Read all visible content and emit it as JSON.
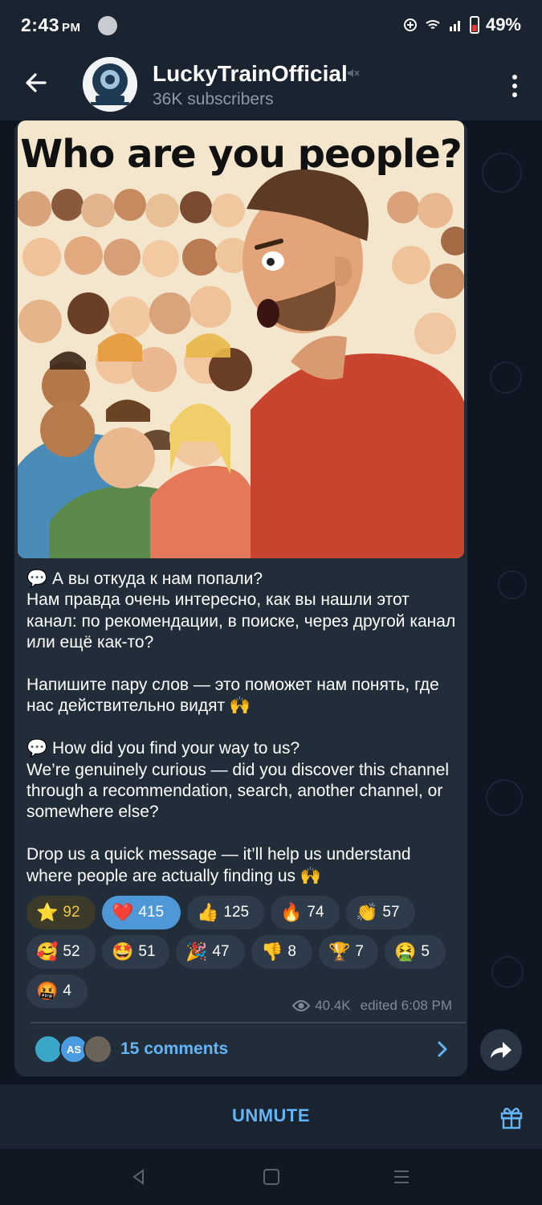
{
  "status_bar": {
    "time": "2:43",
    "ampm": "PM",
    "battery": "49%"
  },
  "header": {
    "channel_name": "LuckyTrainOfficial",
    "subscribers": "36K subscribers"
  },
  "post": {
    "image_title": "Who are you people?",
    "text": "💬 А вы откуда к нам попали?\nНам правда очень интересно, как вы нашли этот канал: по рекомендации, в поиске, через другой канал или ещё как-то?\n\nНапишите пару слов — это поможет нам понять, где нас действительно видят 🙌\n\n💬 How did you find your way to us?\nWe’re genuinely curious — did you discover this channel through a recommendation, search, another channel, or somewhere else?\n\nDrop us a quick message — it’ll help us understand where people are actually finding us 🙌",
    "reactions": [
      {
        "emoji": "⭐",
        "count": "92",
        "kind": "star"
      },
      {
        "emoji": "❤️",
        "count": "415",
        "kind": "selected"
      },
      {
        "emoji": "👍",
        "count": "125",
        "kind": "normal"
      },
      {
        "emoji": "🔥",
        "count": "74",
        "kind": "normal"
      },
      {
        "emoji": "👏",
        "count": "57",
        "kind": "normal"
      },
      {
        "emoji": "🥰",
        "count": "52",
        "kind": "normal"
      },
      {
        "emoji": "🤩",
        "count": "51",
        "kind": "normal"
      },
      {
        "emoji": "🎉",
        "count": "47",
        "kind": "normal"
      },
      {
        "emoji": "👎",
        "count": "8",
        "kind": "normal"
      },
      {
        "emoji": "🏆",
        "count": "7",
        "kind": "normal"
      },
      {
        "emoji": "🤮",
        "count": "5",
        "kind": "normal"
      },
      {
        "emoji": "🤬",
        "count": "4",
        "kind": "normal"
      }
    ],
    "views": "40.4K",
    "edited": "edited 6:08 PM",
    "comments_label": "15 comments",
    "comment_avatar_initials": "AS"
  },
  "bottom": {
    "unmute_label": "UNMUTE"
  },
  "colors": {
    "accent": "#64b5f6",
    "bubble": "#222d3a",
    "background": "#0e1621",
    "selected_reaction": "#4f98d8"
  }
}
